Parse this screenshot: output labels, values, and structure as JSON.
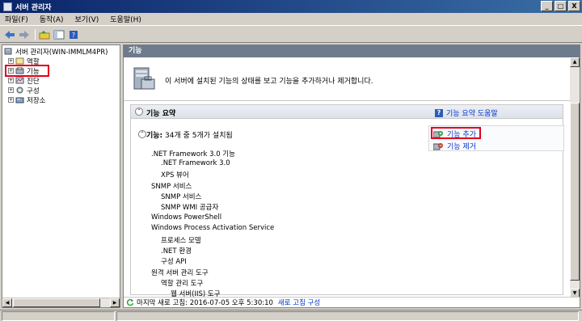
{
  "window": {
    "title": "서버 관리자",
    "controls": [
      "_",
      "□",
      "X"
    ]
  },
  "menu": [
    "파일(F)",
    "동작(A)",
    "보기(V)",
    "도움말(H)"
  ],
  "tree": {
    "root": "서버 관리자(WIN-IMMLM4PR)",
    "items": [
      {
        "label": "역할",
        "icon": "roles-icon"
      },
      {
        "label": "기능",
        "icon": "features-icon",
        "highlighted": true
      },
      {
        "label": "진단",
        "icon": "diagnostics-icon"
      },
      {
        "label": "구성",
        "icon": "configuration-icon"
      },
      {
        "label": "저장소",
        "icon": "storage-icon"
      }
    ]
  },
  "main": {
    "header": "기능",
    "intro": "이 서버에 설치된 기능의 상태를 보고 기능을 추가하거나 제거합니다.",
    "section_title": "기능 요약",
    "help_link": "기능 요약 도움말",
    "sub_label": "기능:",
    "sub_value": "34개 중 5개가 설치됨",
    "actions": [
      {
        "label": "기능 추가",
        "icon": "add-feature-icon",
        "highlighted": true
      },
      {
        "label": "기능 제거",
        "icon": "remove-feature-icon"
      }
    ],
    "features": [
      {
        "text": ".NET Framework 3.0 기능",
        "level": 0
      },
      {
        "text": ".NET Framework 3.0",
        "level": 1
      },
      {
        "text": "XPS 뷰어",
        "level": 1
      },
      {
        "text": "SNMP 서비스",
        "level": 0
      },
      {
        "text": "SNMP 서비스",
        "level": 1
      },
      {
        "text": "SNMP WMI 공급자",
        "level": 1
      },
      {
        "text": "Windows PowerShell",
        "level": 0
      },
      {
        "text": "Windows Process Activation Service",
        "level": 0
      },
      {
        "text": "프로세스 모델",
        "level": 1
      },
      {
        "text": ".NET 환경",
        "level": 1
      },
      {
        "text": "구성 API",
        "level": 1
      },
      {
        "text": "원격 서버 관리 도구",
        "level": 0
      },
      {
        "text": "역할 관리 도구",
        "level": 1
      },
      {
        "text": "웹 서버(IIS) 도구",
        "level": 2
      }
    ],
    "last_refresh": "마지막 새로 고침: 2016-07-05 오후 5:30:10",
    "refresh_link": "새로 고침 구성"
  },
  "colors": {
    "highlight": "#e0001b",
    "link": "#0033cc",
    "header_bg": "#6d7b8d"
  }
}
